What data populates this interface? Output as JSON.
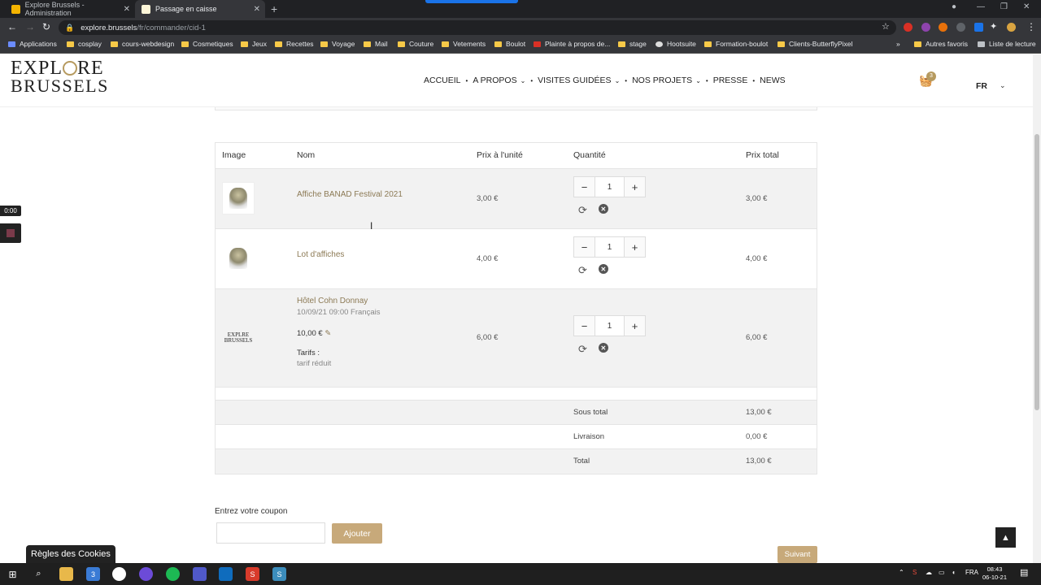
{
  "browser": {
    "tabs": [
      {
        "title": "Explore Brussels - Administration",
        "active": false
      },
      {
        "title": "Passage en caisse",
        "active": true
      }
    ],
    "url_host": "explore.brussels",
    "url_path": "/fr/commander/cid-1",
    "bookmarks": [
      "Applications",
      "cosplay",
      "cours-webdesign",
      "Cosmetiques",
      "Jeux",
      "Recettes",
      "Voyage",
      "Mail",
      "Couture",
      "Vetements",
      "Boulot",
      "Plainte à propos de...",
      "stage",
      "Hootsuite",
      "Formation-boulot",
      "Clients-ButterflyPixel"
    ],
    "bookmarks_right": [
      "Autres favoris",
      "Liste de lecture"
    ],
    "ext_badge": "3"
  },
  "site": {
    "logo_line1a": "EXPL",
    "logo_line1b": "RE",
    "logo_line2": "BRUSSELS",
    "nav": [
      {
        "label": "ACCUEIL",
        "dropdown": false
      },
      {
        "label": "A PROPOS",
        "dropdown": true
      },
      {
        "label": "VISITES GUIDÉES",
        "dropdown": true
      },
      {
        "label": "NOS PROJETS",
        "dropdown": true
      },
      {
        "label": "PRESSE",
        "dropdown": false
      },
      {
        "label": "NEWS",
        "dropdown": false
      }
    ],
    "cart_count": "3",
    "language": "FR"
  },
  "cart": {
    "headers": {
      "image": "Image",
      "name": "Nom",
      "unit_price": "Prix à l'unité",
      "quantity": "Quantité",
      "total_price": "Prix total"
    },
    "items": [
      {
        "name": "Affiche BANAD Festival 2021",
        "unit_price": "3,00 €",
        "quantity": "1",
        "total": "3,00 €"
      },
      {
        "name": "Lot d'affiches",
        "unit_price": "4,00 €",
        "quantity": "1",
        "total": "4,00 €"
      },
      {
        "name": "Hôtel Cohn Donnay",
        "date_lang": "10/09/21 09:00 Français",
        "price_line": "10,00 €",
        "tarifs_label": "Tarifs :",
        "tarif_value": "tarif réduit",
        "unit_price": "6,00 €",
        "quantity": "1",
        "total": "6,00 €"
      }
    ],
    "summary": {
      "subtotal_label": "Sous total",
      "subtotal": "13,00 €",
      "shipping_label": "Livraison",
      "shipping": "0,00 €",
      "total_label": "Total",
      "total": "13,00 €"
    },
    "minus": "−",
    "plus": "+"
  },
  "coupon": {
    "label": "Entrez votre coupon",
    "placeholder": "",
    "button": "Ajouter"
  },
  "next_button": "Suivant",
  "cookie_banner": "Règles des Cookies",
  "recorder_time": "0:00",
  "taskbar": {
    "lang": "FRA",
    "time": "08:43",
    "date": "06-10-21",
    "outlook_badge": "3"
  }
}
